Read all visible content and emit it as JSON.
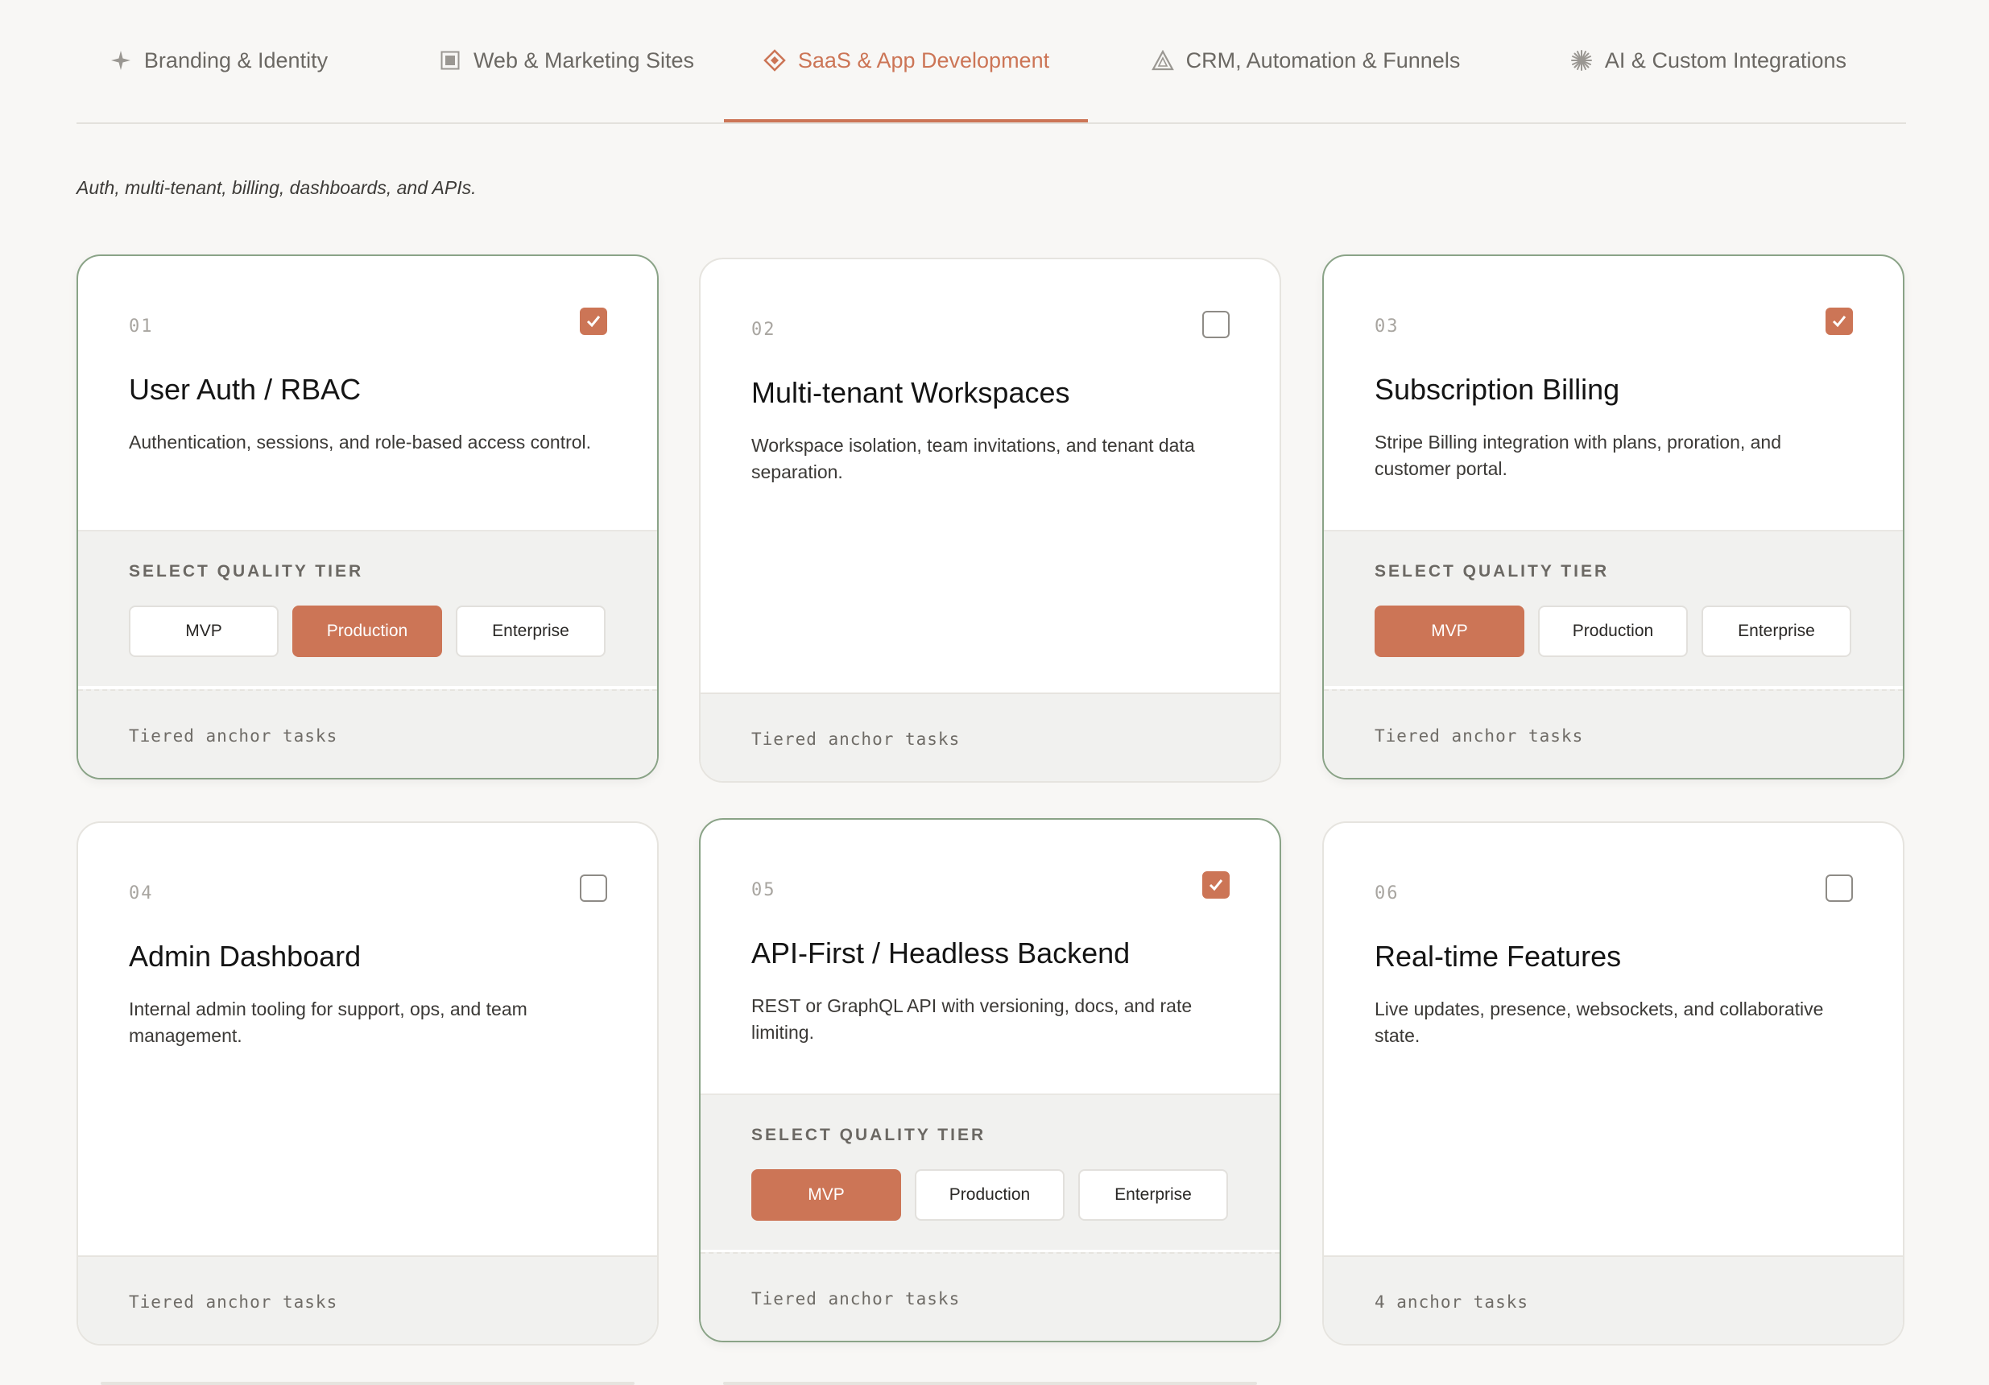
{
  "tabs": [
    {
      "label": "Branding & Identity",
      "icon": "sparkle-icon"
    },
    {
      "label": "Web & Marketing Sites",
      "icon": "window-icon"
    },
    {
      "label": "SaaS & App Development",
      "icon": "diamond-icon",
      "active": true
    },
    {
      "label": "CRM, Automation & Funnels",
      "icon": "triangle-icon"
    },
    {
      "label": "AI & Custom Integrations",
      "icon": "starburst-icon"
    }
  ],
  "subtitle": "Auth, multi-tenant, billing, dashboards, and APIs.",
  "tier_label": "SELECT QUALITY TIER",
  "tier_options": [
    "MVP",
    "Production",
    "Enterprise"
  ],
  "colors": {
    "accent": "#cc7556",
    "selected_border": "#8aa387",
    "background": "#f8f7f5"
  },
  "cards": [
    {
      "num": "01",
      "title": "User Auth / RBAC",
      "desc": "Authentication, sessions, and role-based access control.",
      "selected": true,
      "tier": "Production",
      "footer": "Tiered anchor tasks"
    },
    {
      "num": "02",
      "title": "Multi-tenant Workspaces",
      "desc": "Workspace isolation, team invitations, and tenant data separation.",
      "selected": false,
      "footer": "Tiered anchor tasks"
    },
    {
      "num": "03",
      "title": "Subscription Billing",
      "desc": "Stripe Billing integration with plans, proration, and customer portal.",
      "selected": true,
      "tier": "MVP",
      "footer": "Tiered anchor tasks"
    },
    {
      "num": "04",
      "title": "Admin Dashboard",
      "desc": "Internal admin tooling for support, ops, and team management.",
      "selected": false,
      "footer": "Tiered anchor tasks"
    },
    {
      "num": "05",
      "title": "API-First / Headless Backend",
      "desc": "REST or GraphQL API with versioning, docs, and rate limiting.",
      "selected": true,
      "tier": "MVP",
      "footer": "Tiered anchor tasks"
    },
    {
      "num": "06",
      "title": "Real-time Features",
      "desc": "Live updates, presence, websockets, and collaborative state.",
      "selected": false,
      "footer": "4 anchor tasks"
    }
  ]
}
